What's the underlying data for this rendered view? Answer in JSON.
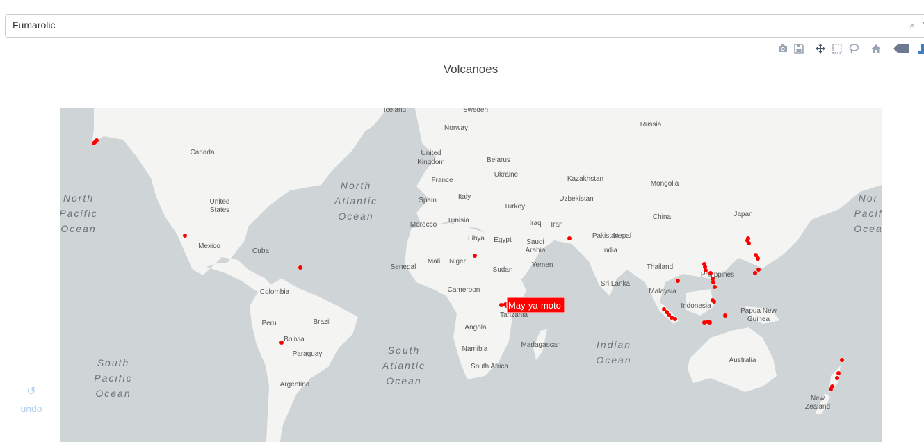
{
  "dropdown": {
    "value": "Fumarolic",
    "clear_glyph": "×",
    "arrow_glyph": "▾"
  },
  "toolbar": {
    "buttons": [
      "camera-icon",
      "save-icon",
      "pan-icon",
      "box-select-icon",
      "lasso-icon",
      "home-icon",
      "hover-closest-icon",
      "hover-compare-icon"
    ]
  },
  "chart": {
    "title": "Volcanoes"
  },
  "undo": {
    "icon": "↺",
    "label": "undo"
  },
  "hover": {
    "label": "May-ya-moto",
    "bg": "#ff0000"
  },
  "colors": {
    "land": "#f4f4f3",
    "water": "#cfd4d6",
    "marker": "#ff0000",
    "toolbar_icon": "#9aa5b4",
    "toolbar_active": "#3f7fc1"
  },
  "map_labels": [
    {
      "text": "Iceland",
      "k": "country"
    },
    {
      "text": "Sweden",
      "k": "country"
    },
    {
      "text": "Norway",
      "k": "country"
    },
    {
      "text": "Russia",
      "k": "country"
    },
    {
      "text": "Canada",
      "k": "country"
    },
    {
      "text": "United",
      "k": "country"
    },
    {
      "text": "Kingdom",
      "k": "country"
    },
    {
      "text": "Belarus",
      "k": "country"
    },
    {
      "text": "Ukraine",
      "k": "country"
    },
    {
      "text": "France",
      "k": "country"
    },
    {
      "text": "Kazakhstan",
      "k": "country"
    },
    {
      "text": "Mongolia",
      "k": "country"
    },
    {
      "text": "North",
      "k": "ocean"
    },
    {
      "text": "Atlantic",
      "k": "ocean"
    },
    {
      "text": "Ocean",
      "k": "ocean"
    },
    {
      "text": "United",
      "k": "country"
    },
    {
      "text": "States",
      "k": "country"
    },
    {
      "text": "Spain",
      "k": "country"
    },
    {
      "text": "Italy",
      "k": "country"
    },
    {
      "text": "Turkey",
      "k": "country"
    },
    {
      "text": "Uzbekistan",
      "k": "country"
    },
    {
      "text": "North",
      "k": "ocean"
    },
    {
      "text": "Pacific",
      "k": "ocean"
    },
    {
      "text": "Ocean",
      "k": "ocean"
    },
    {
      "text": "Nor",
      "k": "ocean"
    },
    {
      "text": "Pacif",
      "k": "ocean"
    },
    {
      "text": "Ocea",
      "k": "ocean"
    },
    {
      "text": "Japan",
      "k": "country"
    },
    {
      "text": "Morocco",
      "k": "country"
    },
    {
      "text": "Tunisia",
      "k": "country"
    },
    {
      "text": "Iraq",
      "k": "country"
    },
    {
      "text": "Iran",
      "k": "country"
    },
    {
      "text": "China",
      "k": "country"
    },
    {
      "text": "Libya",
      "k": "country"
    },
    {
      "text": "Egypt",
      "k": "country"
    },
    {
      "text": "Saudi",
      "k": "country"
    },
    {
      "text": "Arabia",
      "k": "country"
    },
    {
      "text": "Pakistan",
      "k": "country"
    },
    {
      "text": "Nepal",
      "k": "country"
    },
    {
      "text": "Mexico",
      "k": "country"
    },
    {
      "text": "Cuba",
      "k": "country"
    },
    {
      "text": "India",
      "k": "country"
    },
    {
      "text": "Senegal",
      "k": "country"
    },
    {
      "text": "Mali",
      "k": "country"
    },
    {
      "text": "Niger",
      "k": "country"
    },
    {
      "text": "Sudan",
      "k": "country"
    },
    {
      "text": "Yemen",
      "k": "country"
    },
    {
      "text": "Thailand",
      "k": "country"
    },
    {
      "text": "Philippines",
      "k": "country"
    },
    {
      "text": "Sri Lanka",
      "k": "country"
    },
    {
      "text": "Malaysia",
      "k": "country"
    },
    {
      "text": "Colombia",
      "k": "country"
    },
    {
      "text": "Cameroon",
      "k": "country"
    },
    {
      "text": "Indonesia",
      "k": "country"
    },
    {
      "text": "Papua New",
      "k": "country"
    },
    {
      "text": "Guinea",
      "k": "country"
    },
    {
      "text": "Tanzania",
      "k": "country"
    },
    {
      "text": "Peru",
      "k": "country"
    },
    {
      "text": "Brazil",
      "k": "country"
    },
    {
      "text": "Angola",
      "k": "country"
    },
    {
      "text": "Bolivia",
      "k": "country"
    },
    {
      "text": "Madagascar",
      "k": "country"
    },
    {
      "text": "Paraguay",
      "k": "country"
    },
    {
      "text": "Namibia",
      "k": "country"
    },
    {
      "text": "South",
      "k": "ocean"
    },
    {
      "text": "Atlantic",
      "k": "ocean"
    },
    {
      "text": "Ocean",
      "k": "ocean"
    },
    {
      "text": "Indian",
      "k": "ocean"
    },
    {
      "text": "Ocean",
      "k": "ocean"
    },
    {
      "text": "Australia",
      "k": "country"
    },
    {
      "text": "South Africa",
      "k": "country"
    },
    {
      "text": "South",
      "k": "ocean"
    },
    {
      "text": "Pacific",
      "k": "ocean"
    },
    {
      "text": "Ocean",
      "k": "ocean"
    },
    {
      "text": "Argentina",
      "k": "country"
    },
    {
      "text": "New",
      "k": "country"
    },
    {
      "text": "Zealand",
      "k": "country"
    }
  ]
}
